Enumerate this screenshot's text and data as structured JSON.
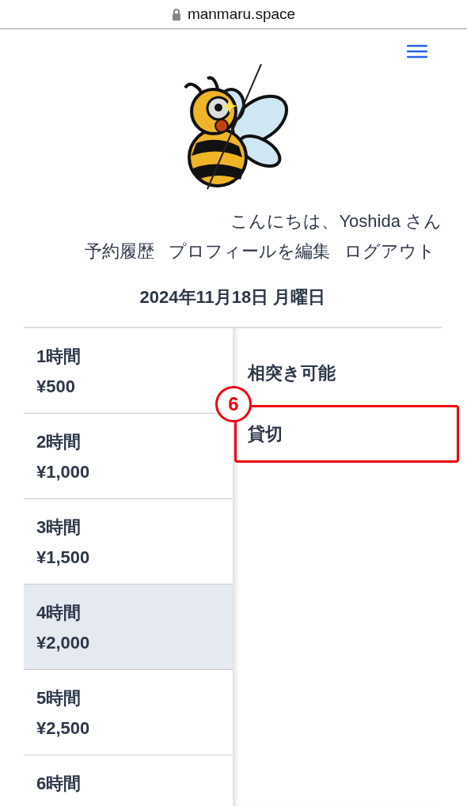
{
  "address_bar": {
    "url": "manmaru.space",
    "secure": true
  },
  "greeting": "こんにちは、Yoshida さん",
  "nav_links": [
    "予約履歴",
    "プロフィールを編集",
    "ログアウト"
  ],
  "date": "2024年11月18日 月曜日",
  "durations": [
    {
      "label": "1時間",
      "price": "¥500",
      "selected": false
    },
    {
      "label": "2時間",
      "price": "¥1,000",
      "selected": false
    },
    {
      "label": "3時間",
      "price": "¥1,500",
      "selected": false
    },
    {
      "label": "4時間",
      "price": "¥2,000",
      "selected": true
    },
    {
      "label": "5時間",
      "price": "¥2,500",
      "selected": false
    },
    {
      "label": "6時間",
      "selected": false
    }
  ],
  "options": [
    {
      "label": "相突き可能",
      "highlighted": false
    },
    {
      "label": "貸切",
      "highlighted": true,
      "annotation": "6"
    }
  ]
}
